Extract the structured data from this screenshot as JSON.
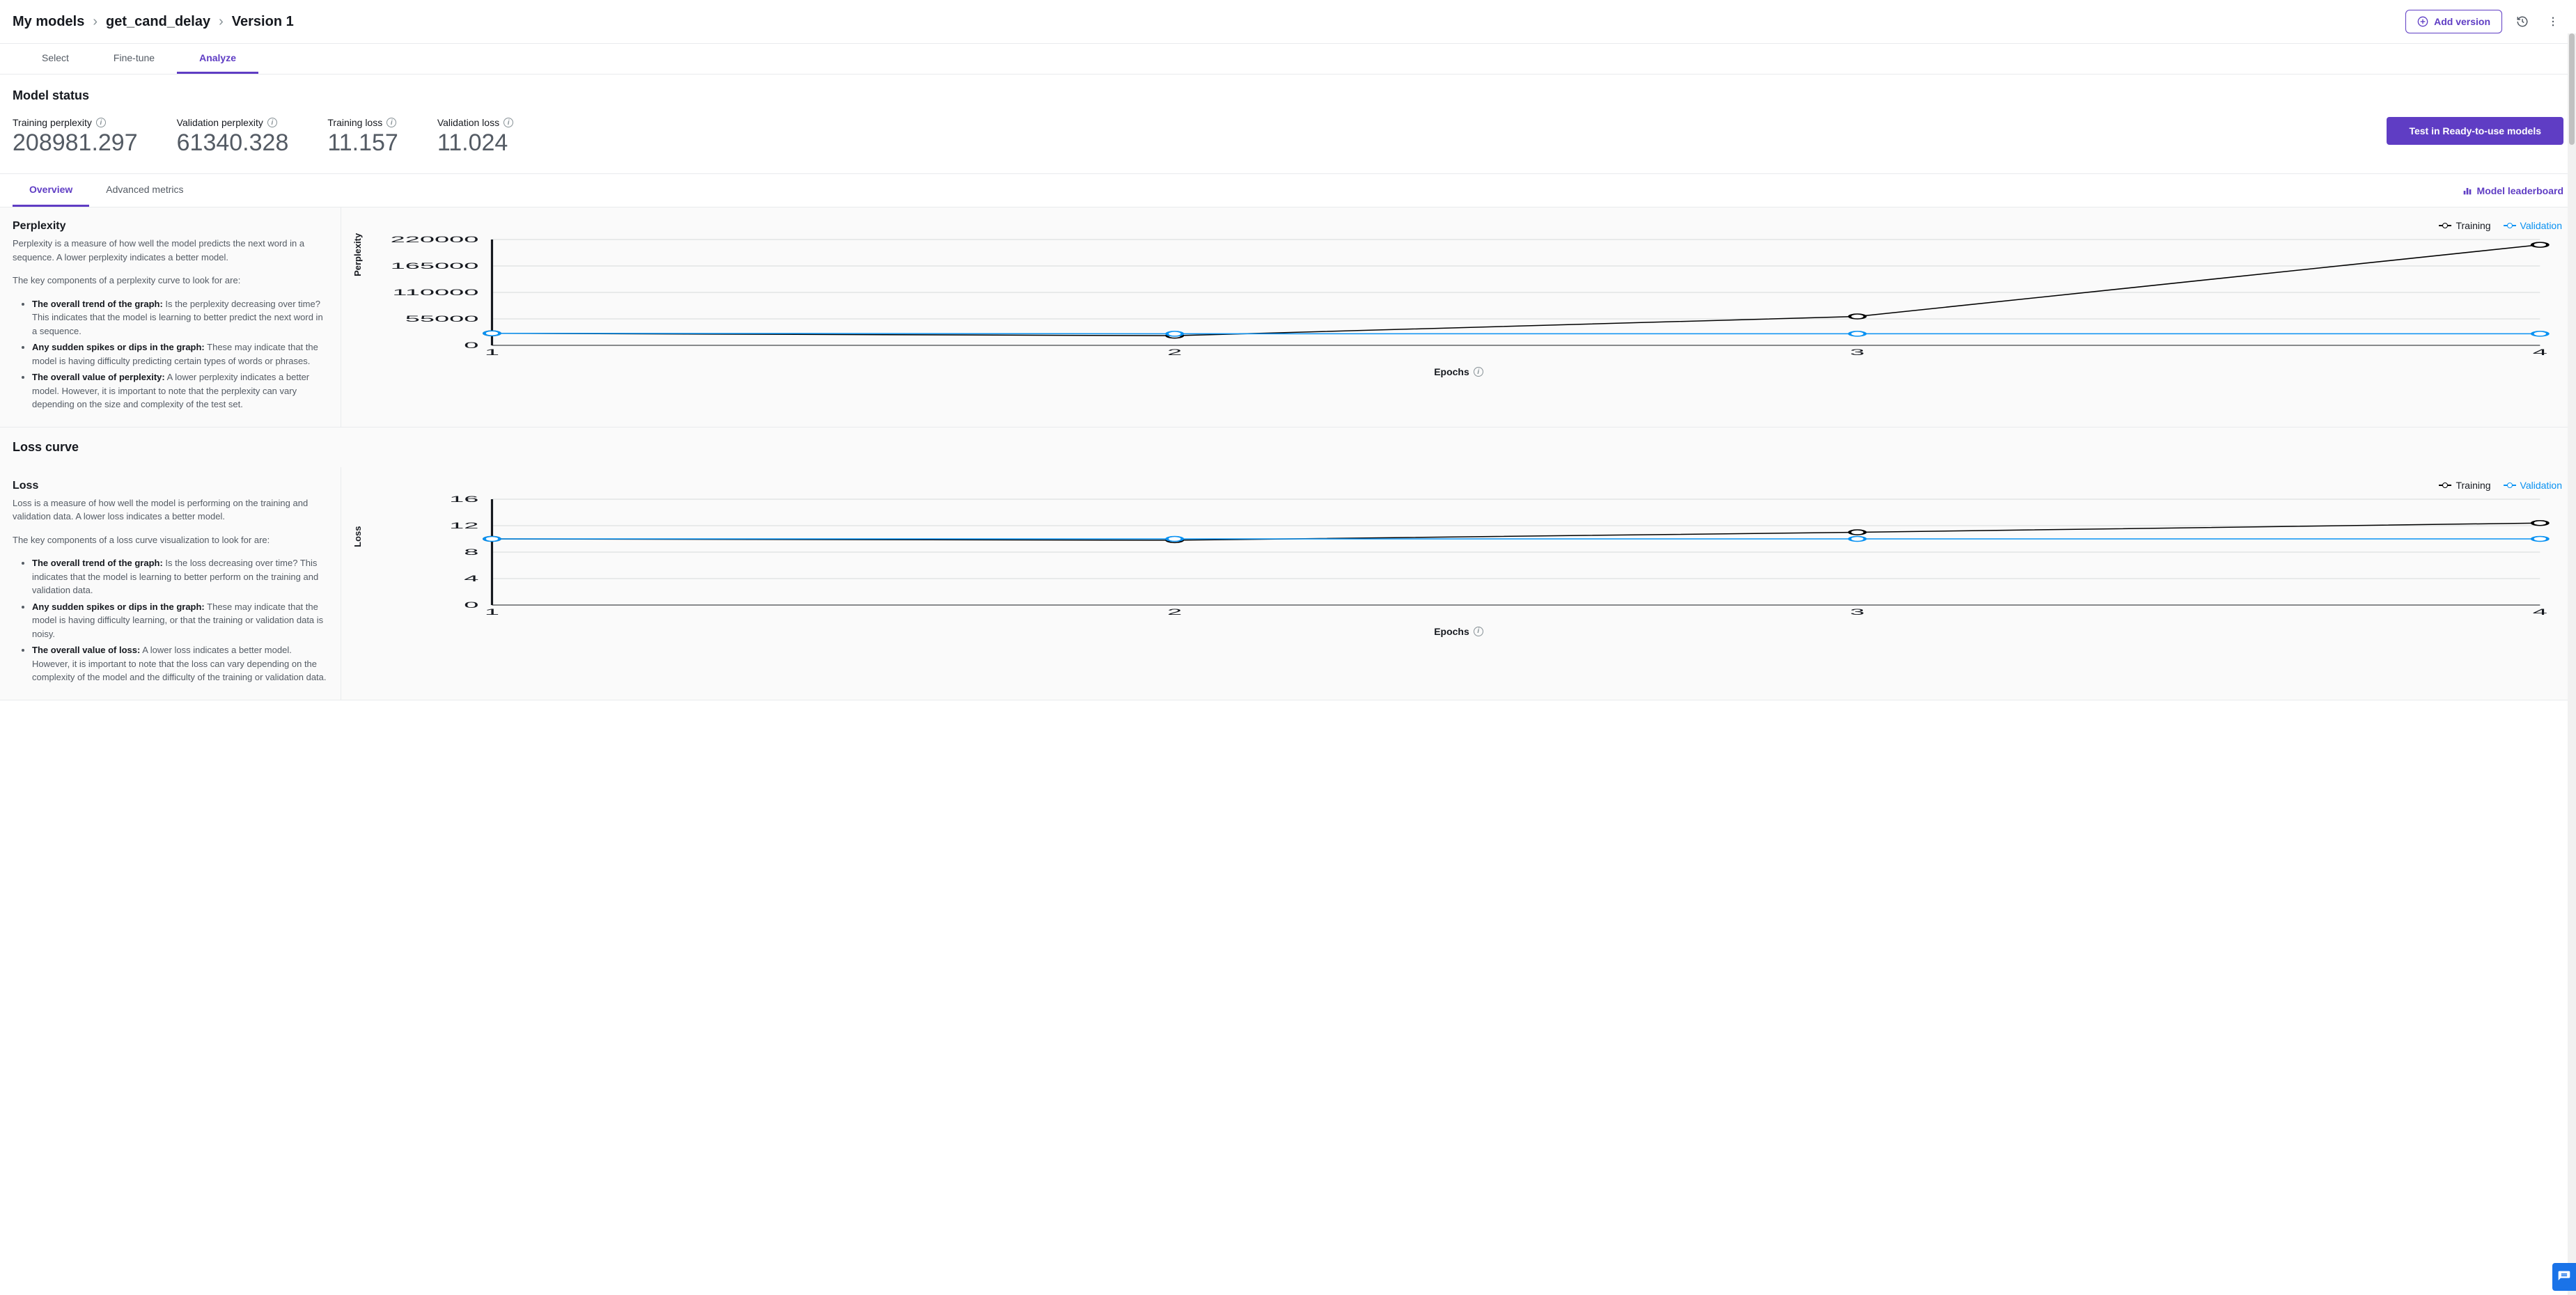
{
  "breadcrumb": {
    "root": "My models",
    "model": "get_cand_delay",
    "version": "Version 1"
  },
  "header_buttons": {
    "add_version": "Add version"
  },
  "main_tabs": {
    "select": "Select",
    "finetune": "Fine-tune",
    "analyze": "Analyze"
  },
  "status": {
    "title": "Model status",
    "metrics": {
      "train_ppl": {
        "label": "Training perplexity",
        "value": "208981.297"
      },
      "val_ppl": {
        "label": "Validation perplexity",
        "value": "61340.328"
      },
      "train_loss": {
        "label": "Training loss",
        "value": "11.157"
      },
      "val_loss": {
        "label": "Validation loss",
        "value": "11.024"
      }
    },
    "test_button": "Test in Ready-to-use models"
  },
  "sub_tabs": {
    "overview": "Overview",
    "advanced": "Advanced metrics"
  },
  "leaderboard_link": "Model leaderboard",
  "perplexity_section": {
    "title": "Perplexity",
    "intro": "Perplexity is a measure of how well the model predicts the next word in a sequence. A lower perplexity indicates a better model.",
    "lead": "The key components of a perplexity curve to look for are:",
    "b1_head": "The overall trend of the graph:",
    "b1_body": " Is the perplexity decreasing over time? This indicates that the model is learning to better predict the next word in a sequence.",
    "b2_head": "Any sudden spikes or dips in the graph:",
    "b2_body": " These may indicate that the model is having difficulty predicting certain types of words or phrases.",
    "b3_head": "The overall value of perplexity:",
    "b3_body": " A lower perplexity indicates a better model. However, it is important to note that the perplexity can vary depending on the size and complexity of the test set."
  },
  "loss_curve_heading": "Loss curve",
  "loss_section": {
    "title": "Loss",
    "intro": "Loss is a measure of how well the model is performing on the training and validation data. A lower loss indicates a better model.",
    "lead": "The key components of a loss curve visualization to look for are:",
    "b1_head": "The overall trend of the graph:",
    "b1_body": " Is the loss decreasing over time? This indicates that the model is learning to better perform on the training and validation data.",
    "b2_head": "Any sudden spikes or dips in the graph:",
    "b2_body": " These may indicate that the model is having difficulty learning, or that the training or validation data is noisy.",
    "b3_head": "The overall value of loss:",
    "b3_body": " A lower loss indicates a better model. However, it is important to note that the loss can vary depending on the complexity of the model and the difficulty of the training or validation data."
  },
  "chart_common": {
    "legend_training": "Training",
    "legend_validation": "Validation",
    "xaxis": "Epochs"
  },
  "chart_data": [
    {
      "type": "line",
      "title": "Perplexity",
      "xlabel": "Epochs",
      "ylabel": "Perplexity",
      "x": [
        1,
        2,
        3,
        4
      ],
      "ylim": [
        0,
        220000
      ],
      "yticks": [
        0,
        55000,
        110000,
        165000,
        220000
      ],
      "series": [
        {
          "name": "Training",
          "values": [
            25000,
            20000,
            60000,
            209000
          ]
        },
        {
          "name": "Validation",
          "values": [
            25000,
            24000,
            24000,
            24000
          ]
        }
      ]
    },
    {
      "type": "line",
      "title": "Loss",
      "xlabel": "Epochs",
      "ylabel": "Loss",
      "x": [
        1,
        2,
        3,
        4
      ],
      "ylim": [
        0,
        16
      ],
      "yticks": [
        0,
        4,
        8,
        12,
        16
      ],
      "series": [
        {
          "name": "Training",
          "values": [
            10.0,
            9.8,
            11.0,
            12.4
          ]
        },
        {
          "name": "Validation",
          "values": [
            10.0,
            10.0,
            10.0,
            10.0
          ]
        }
      ]
    }
  ]
}
